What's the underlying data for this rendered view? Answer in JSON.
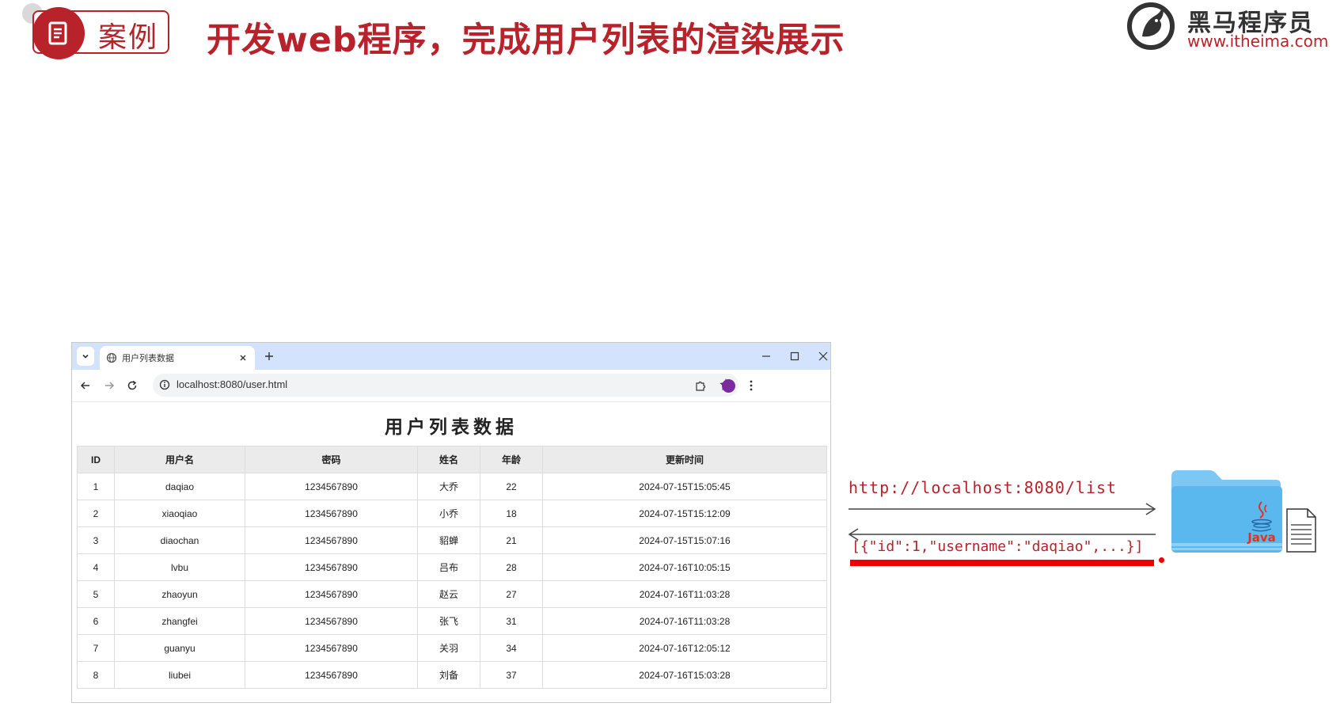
{
  "slide": {
    "badge_label": "案例",
    "title": "开发web程序，完成用户列表的渲染展示",
    "brand_name": "黑马程序员",
    "brand_url": "www.itheima.com"
  },
  "browser": {
    "tab_title": "用户列表数据",
    "url": "localhost:8080/user.html"
  },
  "page": {
    "heading": "用户列表数据",
    "columns": [
      "ID",
      "用户名",
      "密码",
      "姓名",
      "年龄",
      "更新时间"
    ],
    "rows": [
      [
        "1",
        "daqiao",
        "1234567890",
        "大乔",
        "22",
        "2024-07-15T15:05:45"
      ],
      [
        "2",
        "xiaoqiao",
        "1234567890",
        "小乔",
        "18",
        "2024-07-15T15:12:09"
      ],
      [
        "3",
        "diaochan",
        "1234567890",
        "貂蝉",
        "21",
        "2024-07-15T15:07:16"
      ],
      [
        "4",
        "lvbu",
        "1234567890",
        "吕布",
        "28",
        "2024-07-16T10:05:15"
      ],
      [
        "5",
        "zhaoyun",
        "1234567890",
        "赵云",
        "27",
        "2024-07-16T11:03:28"
      ],
      [
        "6",
        "zhangfei",
        "1234567890",
        "张飞",
        "31",
        "2024-07-16T11:03:28"
      ],
      [
        "7",
        "guanyu",
        "1234567890",
        "关羽",
        "34",
        "2024-07-16T12:05:12"
      ],
      [
        "8",
        "liubei",
        "1234567890",
        "刘备",
        "37",
        "2024-07-16T15:03:28"
      ]
    ]
  },
  "diagram": {
    "request_url": "http://localhost:8080/list",
    "response_json": "[{\"id\":1,\"username\":\"daqiao\",...}]",
    "java_label": "Java"
  },
  "colors": {
    "brand_red": "#b8232b",
    "tab_strip": "#d3e3fd",
    "underline_red": "#ee0000",
    "folder_blue": "#5bb8ee"
  }
}
